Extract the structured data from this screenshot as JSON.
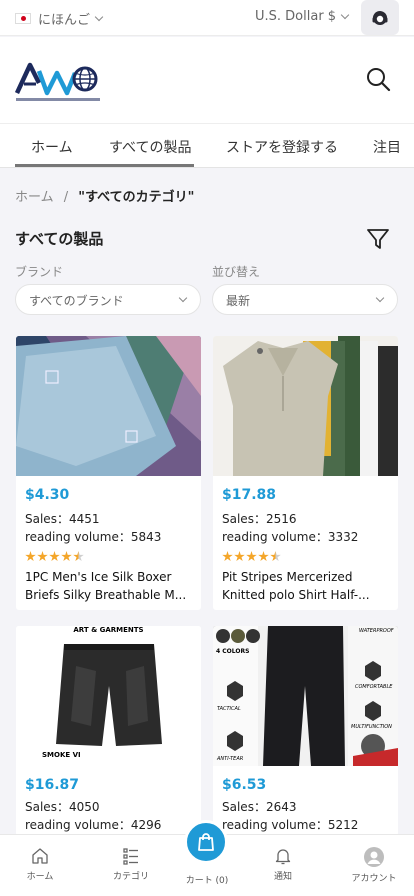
{
  "topbar": {
    "language": "にほんご",
    "currency": "U.S. Dollar $"
  },
  "nav": {
    "items": [
      "ホーム",
      "すべての製品",
      "ストアを登録する",
      "注目"
    ]
  },
  "breadcrumb": {
    "home": "ホーム",
    "separator": "/",
    "current": "\"すべてのカテゴリ\""
  },
  "section": {
    "title": "すべての製品"
  },
  "filters": {
    "brand_label": "ブランド",
    "brand_value": "すべてのブランド",
    "sort_label": "並び替え",
    "sort_value": "最新"
  },
  "products": [
    {
      "price": "$4.30",
      "sales": "Sales：4451",
      "reading": "reading volume：5843",
      "rating": 4.5,
      "name_line1": "1PC Men's Ice Silk Boxer",
      "name_line2": "Briefs Silky Breathable M..."
    },
    {
      "price": "$17.88",
      "sales": "Sales：2516",
      "reading": "reading volume：3332",
      "rating": 4.5,
      "name_line1": "Pit Stripes Mercerized",
      "name_line2": "Knitted polo Shirt Half-..."
    },
    {
      "price": "$16.87",
      "sales": "Sales：4050",
      "reading": "reading volume：4296",
      "image_text_top": "ART & GARMENTS",
      "image_text_bottom": "SMOKE VI"
    },
    {
      "price": "$6.53",
      "sales": "Sales：2643",
      "reading": "reading volume：5212",
      "image_texts": [
        "4 COLORS",
        "WATERPROOF",
        "COMFORTABLE",
        "MULTIFUNCTION",
        "TACTICAL",
        "ANTI-TEAR"
      ]
    }
  ],
  "bottom_nav": {
    "home": "ホーム",
    "category": "カテゴリ",
    "cart": "カート (0)",
    "notify": "通知",
    "account": "アカウント"
  },
  "colors": {
    "accent": "#1f9ad6",
    "star": "#f4a62a",
    "logo_navy": "#1d2a5c"
  }
}
